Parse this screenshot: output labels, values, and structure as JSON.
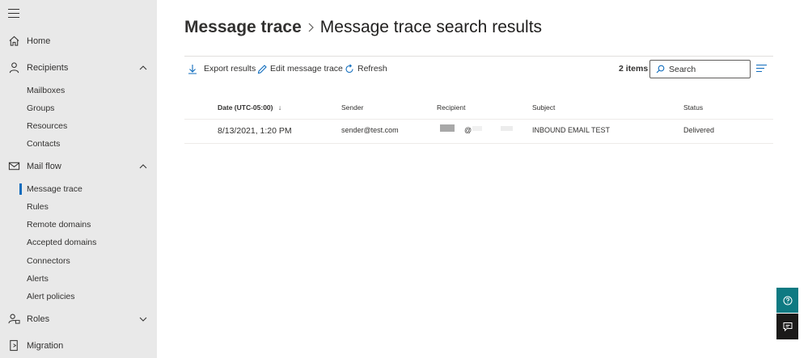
{
  "sidebar": {
    "items": [
      {
        "label": "Home",
        "icon": "home-icon"
      },
      {
        "label": "Recipients",
        "icon": "person-icon",
        "expanded": true
      },
      {
        "label": "Mail flow",
        "icon": "mail-icon",
        "expanded": true
      },
      {
        "label": "Roles",
        "icon": "roles-icon",
        "expanded": false
      },
      {
        "label": "Migration",
        "icon": "migration-icon"
      }
    ],
    "recipients_sub": [
      "Mailboxes",
      "Groups",
      "Resources",
      "Contacts"
    ],
    "mailflow_sub": [
      "Message trace",
      "Rules",
      "Remote domains",
      "Accepted domains",
      "Connectors",
      "Alerts",
      "Alert policies"
    ],
    "active_sub": "Message trace",
    "accent": "#0f6cbd"
  },
  "header": {
    "breadcrumb_root": "Message trace",
    "breadcrumb_current": "Message trace search results"
  },
  "toolbar": {
    "export_label": "Export results",
    "edit_label": "Edit message trace",
    "refresh_label": "Refresh",
    "items_count": "2 items",
    "search_placeholder": "Search"
  },
  "table": {
    "columns": [
      "Date (UTC-05:00)",
      "Sender",
      "Recipient",
      "Subject",
      "Status"
    ],
    "sort_indicator": "↓",
    "rows": [
      {
        "date": "8/13/2021, 1:20 PM",
        "sender": "sender@test.com",
        "recipient_at": "@",
        "subject": "INBOUND EMAIL TEST",
        "status": "Delivered"
      }
    ]
  },
  "colors": {
    "help_button": "#0e7a82",
    "feedback_button": "#1b1a19"
  }
}
